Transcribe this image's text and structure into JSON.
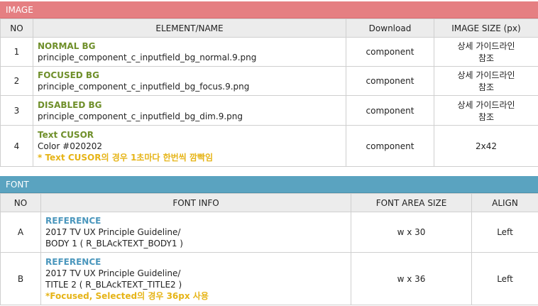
{
  "image_section": {
    "title": "IMAGE",
    "headers": {
      "no": "NO",
      "element": "ELEMENT/NAME",
      "download": "Download",
      "size": "IMAGE SIZE (px)"
    },
    "rows": [
      {
        "no": "1",
        "name": "NORMAL BG",
        "file": "principle_component_c_inputfield_bg_normal.9.png",
        "download": "component",
        "size_line1": "상세 가이드라인",
        "size_line2": "참조"
      },
      {
        "no": "2",
        "name": "FOCUSED BG",
        "file": "principle_component_c_inputfield_bg_focus.9.png",
        "download": "component",
        "size_line1": "상세 가이드라인",
        "size_line2": "참조"
      },
      {
        "no": "3",
        "name": "DISABLED BG",
        "file": "principle_component_c_inputfield_bg_dim.9.png",
        "download": "component",
        "size_line1": "상세 가이드라인",
        "size_line2": "참조"
      },
      {
        "no": "4",
        "name": "Text CUSOR",
        "file": "Color #020202",
        "note": "* Text CUSOR의 경우 1초마다 한번씩 깜빡임",
        "download": "component",
        "size": "2x42"
      }
    ]
  },
  "font_section": {
    "title": "FONT",
    "headers": {
      "no": "NO",
      "info": "FONT INFO",
      "area": "FONT AREA SIZE",
      "align": "ALIGN"
    },
    "rows": [
      {
        "no": "A",
        "ref": "REFERENCE",
        "line1": "2017 TV UX Principle Guideline/",
        "line2": "BODY 1 ( R_BLAckTEXT_BODY1 )",
        "area": "w x 30",
        "align": "Left"
      },
      {
        "no": "B",
        "ref": "REFERENCE",
        "line1": "2017 TV UX Principle Guideline/",
        "line2": "TITLE 2 ( R_BLAckTEXT_TITLE2 )",
        "note": "*Focused, Selected의 경우 36px 사용",
        "area": "w x 36",
        "align": "Left"
      }
    ]
  },
  "colors": {
    "image_banner": "#e57f82",
    "font_banner": "#5aa3c0",
    "green_label": "#6f8f2a",
    "blue_label": "#4b97bd",
    "note": "#e6b417"
  }
}
